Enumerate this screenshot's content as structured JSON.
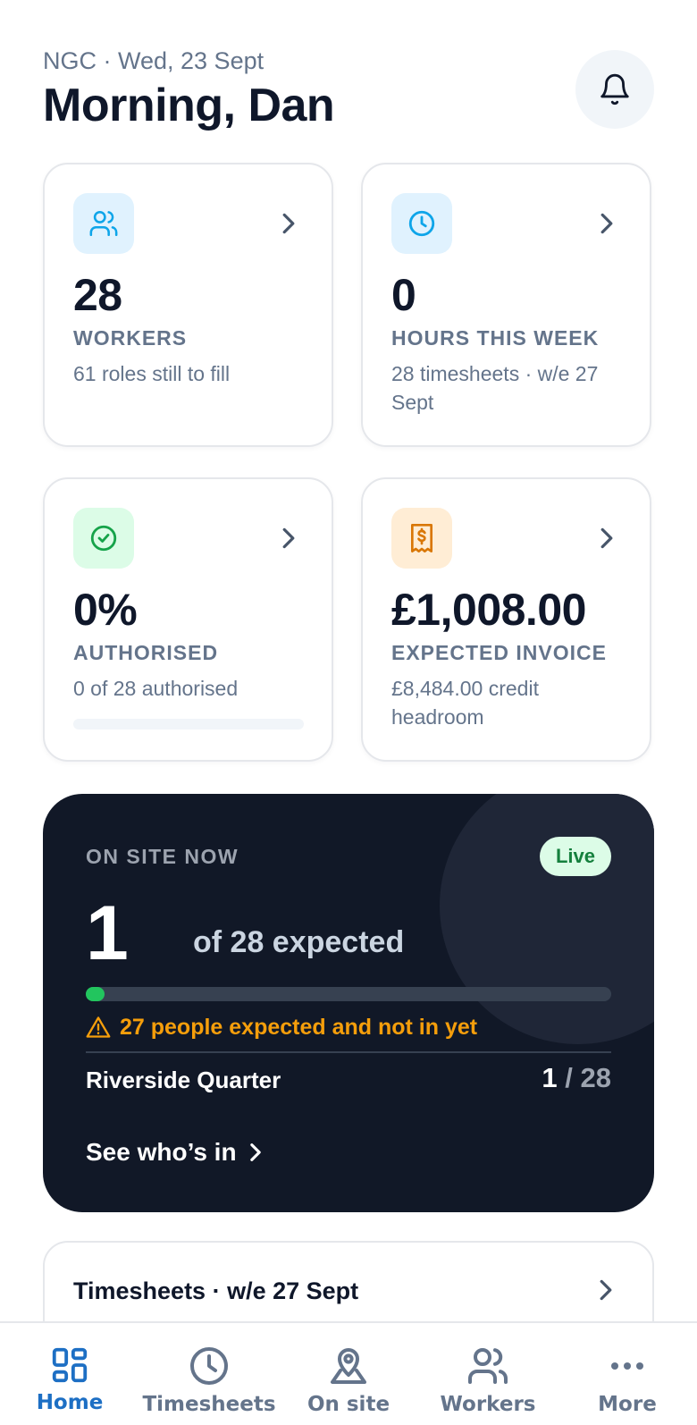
{
  "header": {
    "subtitle": "NGC · Wed, 23 Sept",
    "greeting": "Morning, Dan",
    "bell_icon": "bell-icon"
  },
  "stats": [
    {
      "icon": "workers-icon",
      "value": "28",
      "label": "WORKERS",
      "description": "61 roles still to fill",
      "icon_bg": "#e0f2fe",
      "icon_color": "#0ea5e9"
    },
    {
      "icon": "clock-icon",
      "value": "0",
      "label": "HOURS THIS WEEK",
      "description": "28 timesheets · w/e 27 Sept",
      "icon_bg": "#e0f2fe",
      "icon_color": "#0ea5e9"
    },
    {
      "icon": "check-circle-icon",
      "value": "0%",
      "label": "AUTHORISED",
      "description": "0 of 28 authorised",
      "progress": 0,
      "icon_bg": "#dcfce7",
      "icon_color": "#16a34a"
    },
    {
      "icon": "invoice-icon",
      "value": "£1,008.00",
      "label": "EXPECTED INVOICE",
      "description": "£8,484.00 credit headroom",
      "icon_bg": "#ffedd5",
      "icon_color": "#d97706"
    }
  ],
  "onsite": {
    "title": "ON SITE NOW",
    "badge": "Live",
    "count": "1",
    "expected_text": "of 28 expected",
    "progress": 0.036,
    "warning": "27 people expected and not in yet",
    "site_name": "Riverside Quarter",
    "site_count": "1",
    "site_total": "28",
    "cta": "See who’s in"
  },
  "timesheets_card": {
    "title": "Timesheets · w/e 27 Sept"
  },
  "tabs": [
    {
      "label": "Home",
      "icon": "home-grid-icon",
      "active": true
    },
    {
      "label": "Timesheets",
      "icon": "clock-icon",
      "active": false
    },
    {
      "label": "On site",
      "icon": "map-pin-icon",
      "active": false
    },
    {
      "label": "Workers",
      "icon": "workers-icon",
      "active": false
    },
    {
      "label": "More",
      "icon": "more-dots-icon",
      "active": false
    }
  ],
  "colors": {
    "accent": "#1d6fc4",
    "dark_card": "#111827",
    "live_green": "#22c55e",
    "warning": "#f59e0b"
  }
}
